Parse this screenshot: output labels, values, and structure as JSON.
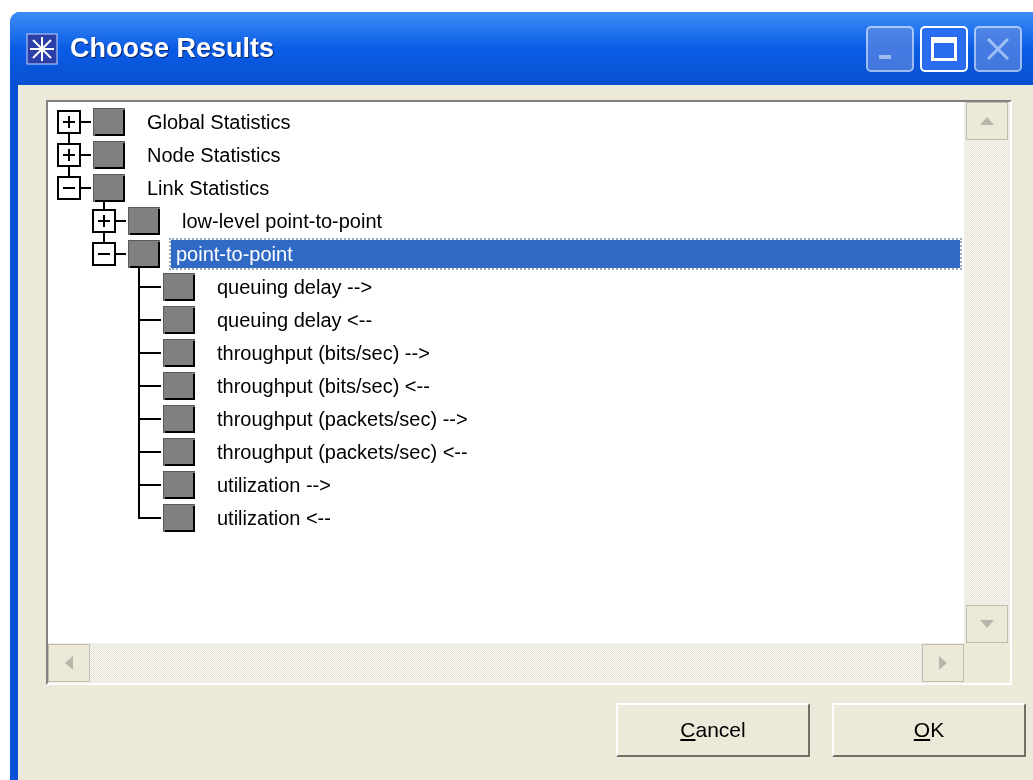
{
  "window": {
    "title": "Choose Results",
    "controls": [
      {
        "kind": "minimize",
        "disabled": true
      },
      {
        "kind": "maximize",
        "disabled": false
      },
      {
        "kind": "close",
        "disabled": true
      }
    ]
  },
  "tree": [
    {
      "label": "Global Statistics",
      "expanded": false,
      "selected": false
    },
    {
      "label": "Node Statistics",
      "expanded": false,
      "selected": false
    },
    {
      "label": "Link Statistics",
      "expanded": true,
      "selected": false,
      "children": [
        {
          "label": "low-level point-to-point",
          "expanded": false,
          "selected": false
        },
        {
          "label": "point-to-point",
          "expanded": true,
          "selected": true,
          "children": [
            {
              "label": "queuing delay -->",
              "selected": false
            },
            {
              "label": "queuing delay <--",
              "selected": false
            },
            {
              "label": "throughput (bits/sec) -->",
              "selected": false
            },
            {
              "label": "throughput (bits/sec) <--",
              "selected": false
            },
            {
              "label": "throughput (packets/sec) -->",
              "selected": false
            },
            {
              "label": "throughput (packets/sec) <--",
              "selected": false
            },
            {
              "label": "utilization -->",
              "selected": false
            },
            {
              "label": "utilization <--",
              "selected": false
            }
          ]
        }
      ]
    }
  ],
  "buttons": [
    {
      "label": "Cancel",
      "underline_first": true
    },
    {
      "label": "OK",
      "underline_first": true
    }
  ]
}
